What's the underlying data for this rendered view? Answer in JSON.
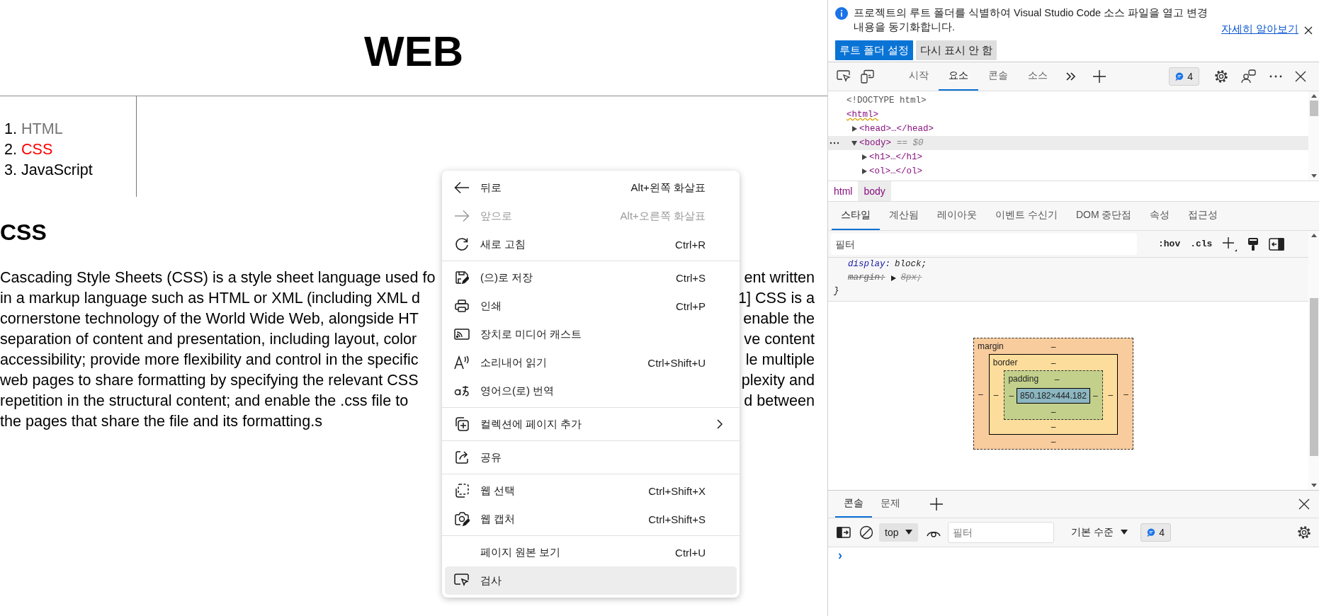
{
  "page": {
    "heading": "WEB",
    "nav": [
      {
        "number": "1.",
        "label": "HTML",
        "color": "#757575"
      },
      {
        "number": "2.",
        "label": "CSS",
        "color": "#ff0000"
      },
      {
        "number": "3.",
        "label": "JavaScript",
        "color": "#000000"
      }
    ],
    "section_heading": "CSS",
    "paragraph_lines": [
      {
        "left": "Cascading Style Sheets (CSS) is a style sheet language used fo",
        "right": "ent written"
      },
      {
        "left": "in a markup language such as HTML or XML (including XML d",
        "right": "1] CSS is a"
      },
      {
        "left": "cornerstone technology of the World Wide Web, alongside HT",
        "right": "enable the"
      },
      {
        "left": "separation of content and presentation, including layout, color",
        "right": "ve content"
      },
      {
        "left": "accessibility; provide more flexibility and control in the specific",
        "right": "le multiple"
      },
      {
        "left": "web pages to share formatting by specifying the relevant CSS",
        "right": "plexity and"
      },
      {
        "left": "repetition in the structural content; and enable the .css file to",
        "right": "d between"
      },
      {
        "left": "the pages that share the file and its formatting.s"
      }
    ]
  },
  "context_menu": {
    "groups": [
      [
        {
          "label": "뒤로",
          "shortcut": "Alt+왼쪽 화살표",
          "disabled": false,
          "selected": false,
          "submenu": false
        },
        {
          "label": "앞으로",
          "shortcut": "Alt+오른쪽 화살표",
          "disabled": true,
          "selected": false,
          "submenu": false
        },
        {
          "label": "새로 고침",
          "shortcut": "Ctrl+R",
          "disabled": false,
          "selected": false,
          "submenu": false
        }
      ],
      [
        {
          "label": "(으)로 저장",
          "shortcut": "Ctrl+S",
          "disabled": false,
          "selected": false,
          "submenu": false
        },
        {
          "label": "인쇄",
          "shortcut": "Ctrl+P",
          "disabled": false,
          "selected": false,
          "submenu": false
        },
        {
          "label": "장치로 미디어 캐스트",
          "disabled": false,
          "selected": false,
          "submenu": false
        },
        {
          "label": "소리내어 읽기",
          "shortcut": "Ctrl+Shift+U",
          "disabled": false,
          "selected": false,
          "submenu": false
        },
        {
          "label": "영어으(로) 번역",
          "disabled": false,
          "selected": false,
          "submenu": false
        }
      ],
      [
        {
          "label": "컬렉션에 페이지 추가",
          "disabled": false,
          "selected": false,
          "submenu": true
        }
      ],
      [
        {
          "label": "공유",
          "disabled": false,
          "selected": false,
          "submenu": false
        }
      ],
      [
        {
          "label": "웹 선택",
          "shortcut": "Ctrl+Shift+X",
          "disabled": false,
          "selected": false,
          "submenu": false
        },
        {
          "label": "웹 캡처",
          "shortcut": "Ctrl+Shift+S",
          "disabled": false,
          "selected": false,
          "submenu": false
        }
      ],
      [
        {
          "label": "페이지 원본 보기",
          "shortcut": "Ctrl+U",
          "disabled": false,
          "selected": false,
          "submenu": false
        },
        {
          "label": "검사",
          "disabled": false,
          "selected": true,
          "submenu": false
        }
      ]
    ]
  },
  "devtools": {
    "infobar": {
      "message_lines": [
        "프로젝트의 루트 폴더를 식별하여 Visual Studio Code 소스 파일을 열고 변경",
        "내용을 동기화합니다."
      ],
      "link": "자세히 알아보기",
      "buttons": [
        {
          "label": "루트 폴더 설정",
          "kind": "primary"
        },
        {
          "label": "다시 표시 안 함",
          "kind": "secondary"
        }
      ]
    },
    "tabs": [
      {
        "label": "시작",
        "selected": false
      },
      {
        "label": "요소",
        "selected": true
      },
      {
        "label": "콘솔",
        "selected": false
      },
      {
        "label": "소스",
        "selected": false
      }
    ],
    "issues_count": "4",
    "dom_tree": [
      {
        "text": "<!DOCTYPE html>",
        "kind": "doctype",
        "selected": false,
        "warning": false
      },
      {
        "text": "<html>",
        "kind": "root",
        "selected": false,
        "warning": true,
        "children": [
          {
            "text": "<head>…</head>",
            "kind": "element",
            "expanded": false,
            "selected": false,
            "warning": false
          },
          {
            "text": "<body>",
            "kind": "element",
            "expanded": true,
            "selected": true,
            "warning": false,
            "suffix": "== $0",
            "children": [
              {
                "text": "<h1>…</h1>",
                "kind": "element",
                "expanded": false,
                "selected": false,
                "warning": false
              },
              {
                "text": "<ol>…</ol>",
                "kind": "element",
                "expanded": false,
                "selected": false,
                "warning": false
              }
            ]
          }
        ]
      }
    ],
    "breadcrumbs": [
      {
        "label": "html",
        "selected": false
      },
      {
        "label": "body",
        "selected": true
      }
    ],
    "styles_tabs": [
      {
        "label": "스타일",
        "selected": true
      },
      {
        "label": "계산됨",
        "selected": false
      },
      {
        "label": "레이아웃",
        "selected": false
      },
      {
        "label": "이벤트 수신기",
        "selected": false
      },
      {
        "label": "DOM 중단점",
        "selected": false
      },
      {
        "label": "속성",
        "selected": false
      },
      {
        "label": "접근성",
        "selected": false
      }
    ],
    "filter_placeholder": "필터",
    "style_buttons": [
      ":hov",
      ".cls"
    ],
    "css_lines": [
      {
        "property": "display:",
        "value": "block;",
        "overridden": false,
        "expandable": false
      },
      {
        "property": "margin:",
        "value": "8px;",
        "overridden": true,
        "expandable": true
      }
    ],
    "closing_brace": "}",
    "box_model": {
      "margin": {
        "label": "margin",
        "top": "–",
        "right": "–",
        "bottom": "–",
        "left": "–"
      },
      "border": {
        "label": "border",
        "top": "–",
        "right": "–",
        "bottom": "–",
        "left": "–"
      },
      "padding": {
        "label": "padding",
        "top": "–",
        "right": "–",
        "bottom": "–",
        "left": "–"
      },
      "content": "850.182×444.182"
    },
    "drawer": {
      "tabs": [
        {
          "label": "콘솔",
          "selected": true
        },
        {
          "label": "문제",
          "selected": false
        }
      ],
      "context": "top",
      "filter_placeholder": "필터",
      "log_levels": "기본 수준",
      "issues_count": "4",
      "prompt": "›"
    }
  }
}
